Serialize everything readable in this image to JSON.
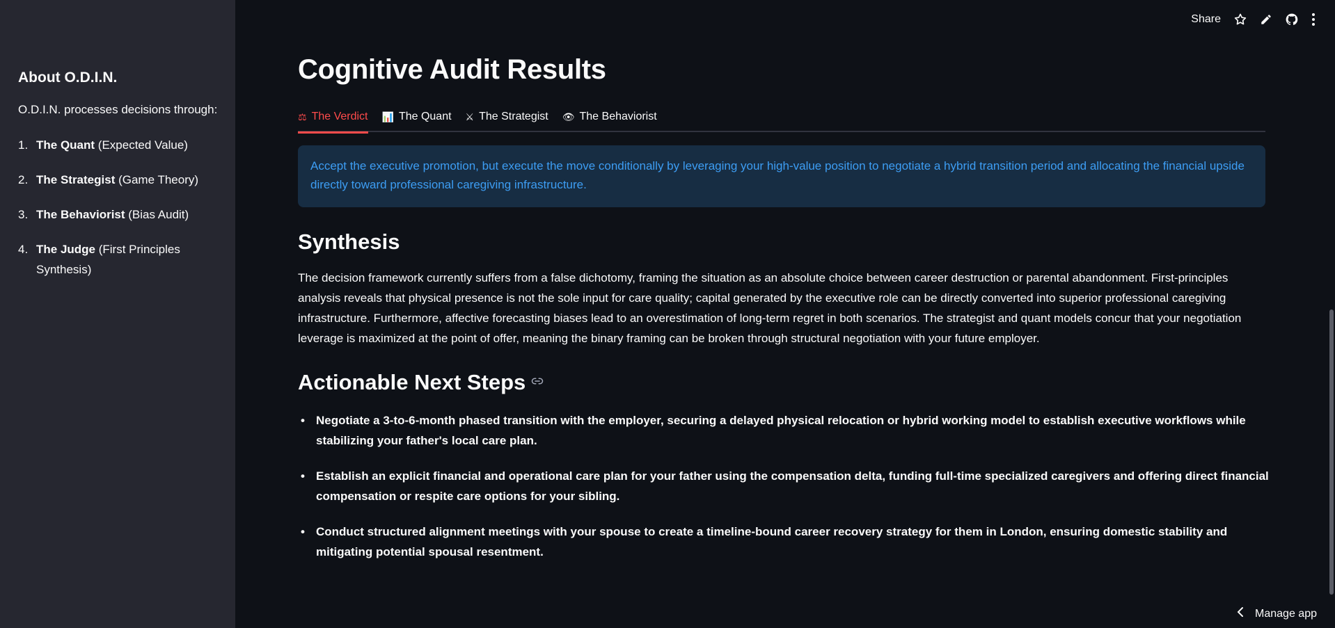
{
  "sidebar": {
    "title": "About O.D.I.N.",
    "intro": "O.D.I.N. processes decisions through:",
    "items": [
      {
        "num": "1.",
        "bold": "The Quant",
        "rest": " (Expected Value)"
      },
      {
        "num": "2.",
        "bold": "The Strategist",
        "rest": " (Game Theory)"
      },
      {
        "num": "3.",
        "bold": "The Behaviorist",
        "rest": " (Bias Audit)"
      },
      {
        "num": "4.",
        "bold": "The Judge",
        "rest": " (First Principles Synthesis)"
      }
    ]
  },
  "toolbar": {
    "share_label": "Share",
    "icons": [
      "star-icon",
      "pencil-icon",
      "github-icon",
      "kebab-menu-icon"
    ]
  },
  "main": {
    "title": "Cognitive Audit Results",
    "tabs": [
      {
        "icon": "⚖",
        "label": "The Verdict"
      },
      {
        "icon": "📊",
        "label": "The Quant"
      },
      {
        "icon": "⚔",
        "label": "The Strategist"
      },
      {
        "icon": "👁",
        "label": "The Behaviorist"
      }
    ],
    "verdict": "Accept the executive promotion, but execute the move conditionally by leveraging your high-value position to negotiate a hybrid transition period and allocating the financial upside directly toward professional caregiving infrastructure.",
    "synthesis_title": "Synthesis",
    "synthesis_body": "The decision framework currently suffers from a false dichotomy, framing the situation as an absolute choice between career destruction or parental abandonment. First-principles analysis reveals that physical presence is not the sole input for care quality; capital generated by the executive role can be directly converted into superior professional caregiving infrastructure. Furthermore, affective forecasting biases lead to an overestimation of long-term regret in both scenarios. The strategist and quant models concur that your negotiation leverage is maximized at the point of offer, meaning the binary framing can be broken through structural negotiation with your future employer.",
    "steps_title": "Actionable Next Steps",
    "steps": [
      "Negotiate a 3-to-6-month phased transition with the employer, securing a delayed physical relocation or hybrid working model to establish executive workflows while stabilizing your father's local care plan.",
      "Establish an explicit financial and operational care plan for your father using the compensation delta, funding full-time specialized caregivers and offering direct financial compensation or respite care options for your sibling.",
      "Conduct structured alignment meetings with your spouse to create a timeline-bound career recovery strategy for them in London, ensuring domestic stability and mitigating potential spousal resentment."
    ]
  },
  "manage_label": "Manage app",
  "colors": {
    "background": "#0e1117",
    "sidebar": "#262730",
    "accent": "#ff4b4b",
    "info_bg": "#172d43",
    "info_text": "#3d9df3"
  }
}
